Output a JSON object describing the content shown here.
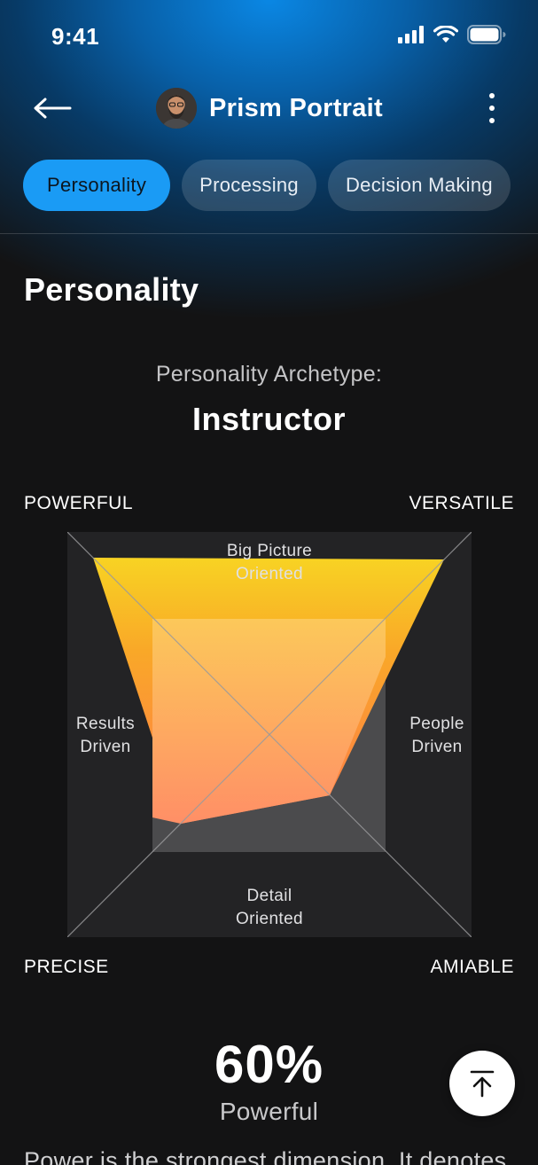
{
  "status_bar": {
    "time": "9:41"
  },
  "header": {
    "title": "Prism Portrait",
    "back_icon": "arrow-left-icon",
    "more_icon": "more-vertical-icon"
  },
  "tabs": [
    {
      "label": "Personality",
      "active": true
    },
    {
      "label": "Processing",
      "active": false
    },
    {
      "label": "Decision Making",
      "active": false
    }
  ],
  "section": {
    "title": "Personality",
    "archetype_label": "Personality Archetype:",
    "archetype_value": "Instructor"
  },
  "quadrants": {
    "top_left": "POWERFUL",
    "top_right": "VERSATILE",
    "bottom_left": "PRECISE",
    "bottom_right": "AMIABLE"
  },
  "axes": {
    "top": "Big Picture\nOriented",
    "left": "Results\nDriven",
    "right": "People\nDriven",
    "bottom": "Detail\nOriented"
  },
  "metric": {
    "value": "60%",
    "label": "Powerful"
  },
  "description": "Power is the strongest dimension. It denotes",
  "colors": {
    "accent": "#1a9bf5",
    "fill_top": "#f6c81f",
    "fill_bottom": "#ff8a5b",
    "background": "#131314"
  }
}
